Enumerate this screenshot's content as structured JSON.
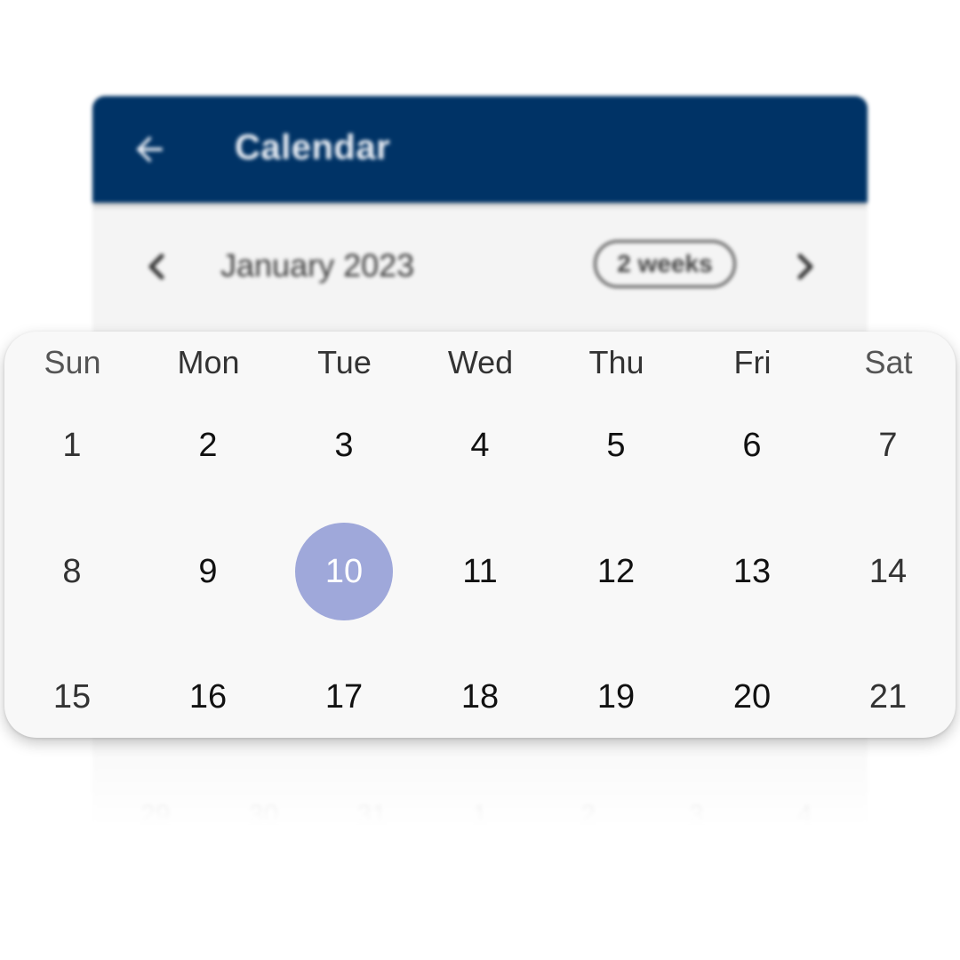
{
  "header": {
    "title": "Calendar",
    "back_icon": "arrow-left-icon",
    "background_color": "#003366"
  },
  "navigation": {
    "month_label": "January 2023",
    "view_mode": "2 weeks",
    "prev_icon": "chevron-left-icon",
    "next_icon": "chevron-right-icon"
  },
  "calendar": {
    "weekdays": [
      "Sun",
      "Mon",
      "Tue",
      "Wed",
      "Thu",
      "Fri",
      "Sat"
    ],
    "weeks": [
      [
        "1",
        "2",
        "3",
        "4",
        "5",
        "6",
        "7"
      ],
      [
        "8",
        "9",
        "10",
        "11",
        "12",
        "13",
        "14"
      ],
      [
        "15",
        "16",
        "17",
        "18",
        "19",
        "20",
        "21"
      ]
    ],
    "selected_day": "10",
    "selected_color": "#9fa8da"
  },
  "background_week": [
    "29",
    "30",
    "31",
    "1",
    "2",
    "3",
    "4"
  ]
}
